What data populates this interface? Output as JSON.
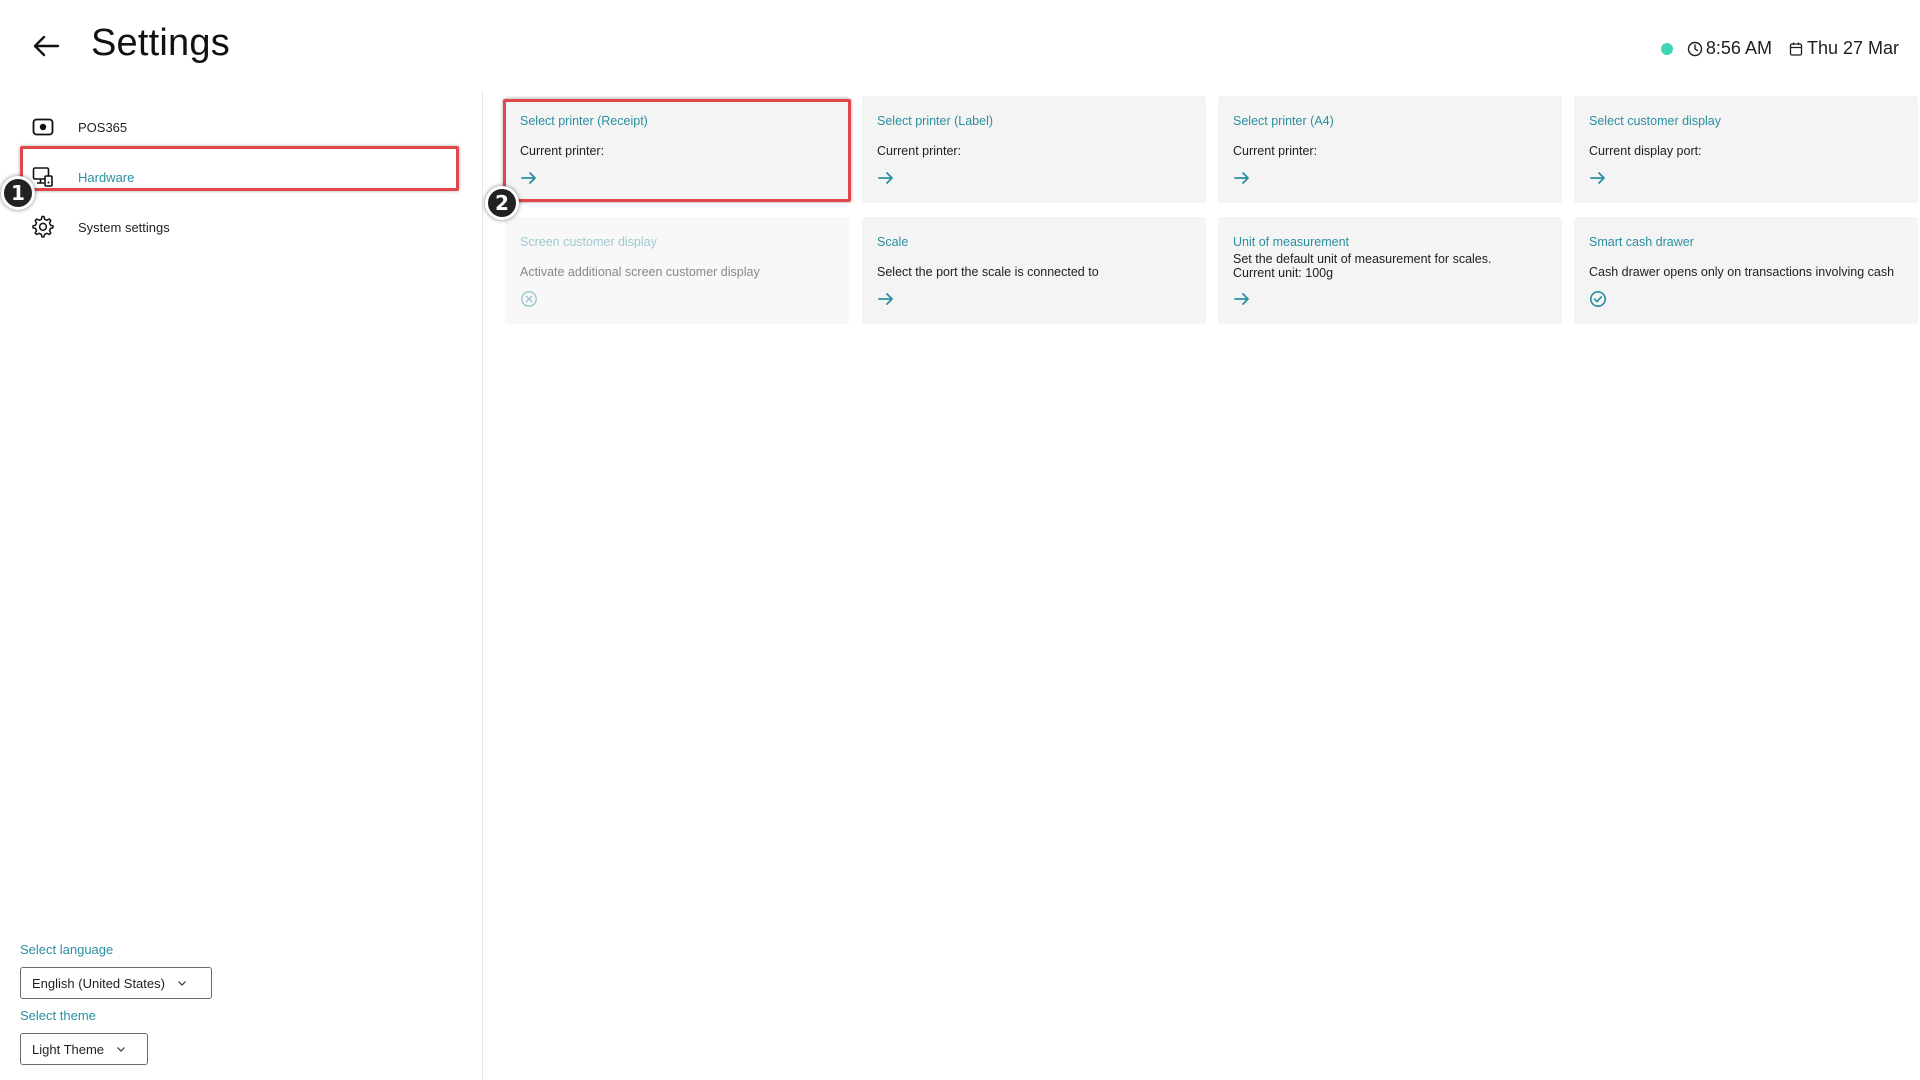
{
  "header": {
    "title": "Settings",
    "time": "8:56 AM",
    "date": "Thu 27 Mar",
    "status_color": "#3fd6b8"
  },
  "sidebar": {
    "items": [
      {
        "label": "POS365",
        "icon": "pos-device-icon",
        "active": false
      },
      {
        "label": "Hardware",
        "icon": "hardware-icon",
        "active": true
      },
      {
        "label": "System settings",
        "icon": "gear-icon",
        "active": false
      }
    ],
    "language_label": "Select language",
    "language_value": "English (United States)",
    "theme_label": "Select theme",
    "theme_value": "Light Theme"
  },
  "cards": [
    {
      "title": "Select printer (Receipt)",
      "desc": "Current printer:",
      "icon": "arrow-right-icon"
    },
    {
      "title": "Select printer (Label)",
      "desc": "Current printer:",
      "icon": "arrow-right-icon"
    },
    {
      "title": "Select printer (A4)",
      "desc": "Current printer:",
      "icon": "arrow-right-icon"
    },
    {
      "title": "Select customer display",
      "desc": "Current display port:",
      "icon": "arrow-right-icon"
    },
    {
      "title": "Screen customer display",
      "desc": "Activate additional screen customer display",
      "icon": "x-circle-icon",
      "disabled": true
    },
    {
      "title": "Scale",
      "desc": "Select the port the scale is connected to",
      "icon": "arrow-right-icon"
    },
    {
      "title": "Unit of measurement",
      "desc_line1": "Set the default unit of measurement for scales.",
      "desc_line2": "Current unit: 100g",
      "icon": "arrow-right-icon"
    },
    {
      "title": "Smart cash drawer",
      "desc": "Cash drawer opens only on transactions involving cash",
      "icon": "check-circle-icon"
    }
  ],
  "annotations": {
    "badge1": "1",
    "badge2": "2"
  },
  "colors": {
    "accent": "#2a8fa0",
    "card_bg": "#f4f4f4",
    "highlight": "#e0474c"
  }
}
